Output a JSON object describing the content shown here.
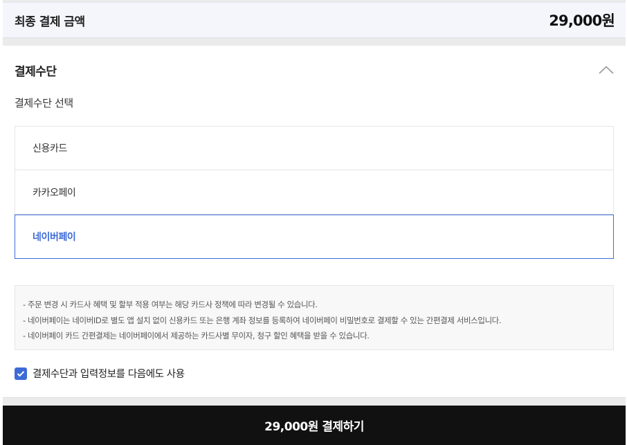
{
  "summary": {
    "label": "최종 결제 금액",
    "amount": "29,000원"
  },
  "payment": {
    "section_title": "결제수단",
    "subtitle": "결제수단 선택",
    "methods": [
      {
        "label": "신용카드",
        "selected": false
      },
      {
        "label": "카카오페이",
        "selected": false
      },
      {
        "label": "네이버페이",
        "selected": true
      }
    ],
    "notices": [
      "- 주문 변경 시 카드사 혜택 및 할부 적용 여부는 해당 카드사 정책에 따라 변경될 수 있습니다.",
      "- 네이버페이는 네이버ID로 별도 앱 설치 없이 신용카드 또는 은행 계좌 정보를 등록하여 네이버페이 비밀번호로 결제할 수 있는 간편결제 서비스입니다.",
      "- 네이버페이 카드 간편결제는 네이버페이에서 제공하는 카드사별 무이자, 청구 할인 혜택을 받을 수 있습니다."
    ],
    "save_info": {
      "label": "결제수단과 입력정보를 다음에도 사용",
      "checked": true
    }
  },
  "pay_button": {
    "label": "29,000원 결제하기"
  },
  "colors": {
    "accent": "#3d6bd6",
    "button_bg": "#111111",
    "summary_bg": "#f4f6fc"
  }
}
